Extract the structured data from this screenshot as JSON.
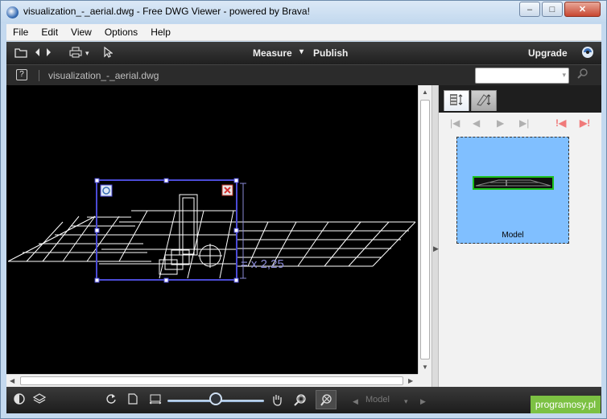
{
  "window": {
    "title": "visualization_-_aerial.dwg - Free DWG Viewer - powered by Brava!",
    "controls": {
      "minimize": "–",
      "maximize": "□",
      "close": "✕"
    }
  },
  "menu": [
    "File",
    "Edit",
    "View",
    "Options",
    "Help"
  ],
  "toolbar": {
    "measure_label": "Measure",
    "measure_arrow": "▾",
    "publish_label": "Publish",
    "upgrade_label": "Upgrade"
  },
  "filebar": {
    "help_label": "?",
    "filename": "visualization_-_aerial.dwg",
    "search_value": ""
  },
  "canvas": {
    "dimension_text": "= x 2,25",
    "background": "#000000",
    "selection_color": "#4b4bd6",
    "drawing_color": "#ffffff"
  },
  "right_panel": {
    "thumbnail_label": "Model",
    "thumbnail_bg": "#80bfff",
    "thumbnail_border": "#1bbf1b"
  },
  "bottombar": {
    "model_select": "Model",
    "model_arrow": "▾",
    "zoom_level": 0.5
  },
  "watermark": "programosy.pl",
  "icons": {
    "open": "open-folder-icon",
    "back": "back-arrow-icon",
    "forward": "forward-arrow-icon",
    "print": "printer-icon",
    "select": "pointer-icon",
    "brava": "brava-logo-icon",
    "search": "search-icon"
  }
}
